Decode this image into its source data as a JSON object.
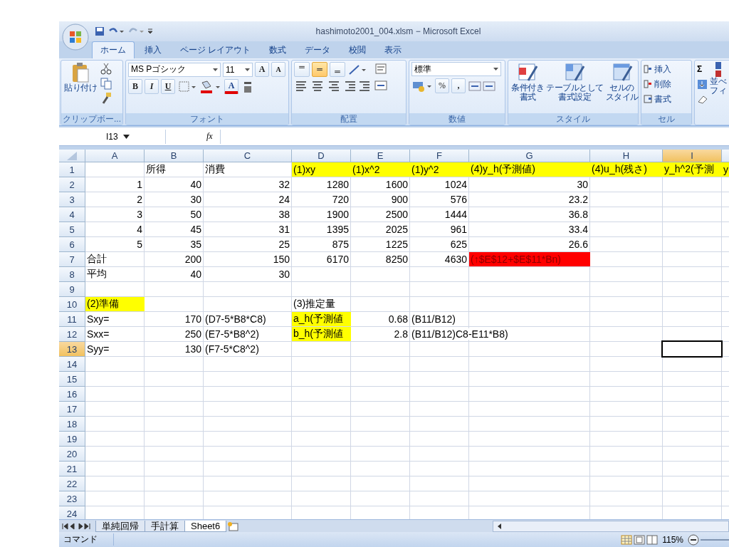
{
  "window": {
    "title": "hashimoto2001_004.xlsm − Microsoft Excel"
  },
  "ribbon_tabs": [
    {
      "label": "ホーム",
      "selected": true
    },
    {
      "label": "挿入",
      "selected": false
    },
    {
      "label": "ページ レイアウト",
      "selected": false
    },
    {
      "label": "数式",
      "selected": false
    },
    {
      "label": "データ",
      "selected": false
    },
    {
      "label": "校閲",
      "selected": false
    },
    {
      "label": "表示",
      "selected": false
    }
  ],
  "ribbon": {
    "clipboard": {
      "paste": "貼り付け",
      "label": "クリップボー..."
    },
    "font": {
      "name": "MS Pゴシック",
      "size": "11",
      "grow": "A",
      "shrink": "A",
      "bold": "B",
      "italic": "I",
      "underline": "U",
      "font_color": "A",
      "label": "フォント"
    },
    "alignment": {
      "vertical": [
        {
          "selected": false
        },
        {
          "selected": true
        },
        {
          "selected": false
        }
      ],
      "label": "配置"
    },
    "number": {
      "format": "標準",
      "percent": "%",
      "comma": ",",
      "label": "数値"
    },
    "styles": {
      "buttons": [
        [
          "条件付き",
          "書式"
        ],
        [
          "テーブルとして",
          "書式設定"
        ],
        [
          "セルの",
          "スタイル"
        ]
      ],
      "label": "スタイル"
    },
    "cells": {
      "buttons": [
        "挿入",
        "削除",
        "書式"
      ],
      "label": "セル"
    },
    "editing": {
      "sum": "Σ",
      "sort": [
        "並べ",
        "フィ"
      ]
    }
  },
  "name_box": "I13",
  "formula_bar": {
    "fx": "fx"
  },
  "columns": [
    {
      "label": "A",
      "selected": false
    },
    {
      "label": "B",
      "selected": false
    },
    {
      "label": "C",
      "selected": false
    },
    {
      "label": "D",
      "selected": false
    },
    {
      "label": "E",
      "selected": false
    },
    {
      "label": "F",
      "selected": false
    },
    {
      "label": "G",
      "selected": false
    },
    {
      "label": "H",
      "selected": false
    },
    {
      "label": "I",
      "selected": true
    }
  ],
  "rows": [
    {
      "label": "1",
      "selected": false,
      "cells": [
        null,
        {
          "text": "所得",
          "kind": "text"
        },
        {
          "text": "消費",
          "kind": "text"
        },
        {
          "text": "(1)xy",
          "kind": "text",
          "color": "#ffff00"
        },
        {
          "text": "(1)x^2",
          "kind": "text",
          "color": "#ffff00"
        },
        {
          "text": "(1)y^2",
          "kind": "text",
          "color": "#ffff00"
        },
        {
          "text": "(4)y_h(予測値)",
          "kind": "text",
          "color": "#ffff00"
        },
        {
          "text": "(4)u_h(残さ)",
          "kind": "text",
          "color": "#ffff00"
        },
        {
          "text": "y_h^2(予測",
          "kind": "text",
          "color": "#ffff00"
        },
        {
          "text": "y",
          "kind": "text",
          "color": "#ffff00"
        }
      ]
    },
    {
      "label": "2",
      "selected": false,
      "cells": [
        {
          "text": "1",
          "kind": "number"
        },
        {
          "text": "40",
          "kind": "number"
        },
        {
          "text": "32",
          "kind": "number"
        },
        {
          "text": "1280",
          "kind": "number"
        },
        {
          "text": "1600",
          "kind": "number"
        },
        {
          "text": "1024",
          "kind": "number"
        },
        {
          "text": "30",
          "kind": "number"
        }
      ]
    },
    {
      "label": "3",
      "selected": false,
      "cells": [
        {
          "text": "2",
          "kind": "number"
        },
        {
          "text": "30",
          "kind": "number"
        },
        {
          "text": "24",
          "kind": "number"
        },
        {
          "text": "720",
          "kind": "number"
        },
        {
          "text": "900",
          "kind": "number"
        },
        {
          "text": "576",
          "kind": "number"
        },
        {
          "text": "23.2",
          "kind": "number"
        }
      ]
    },
    {
      "label": "4",
      "selected": false,
      "cells": [
        {
          "text": "3",
          "kind": "number"
        },
        {
          "text": "50",
          "kind": "number"
        },
        {
          "text": "38",
          "kind": "number"
        },
        {
          "text": "1900",
          "kind": "number"
        },
        {
          "text": "2500",
          "kind": "number"
        },
        {
          "text": "1444",
          "kind": "number"
        },
        {
          "text": "36.8",
          "kind": "number"
        }
      ]
    },
    {
      "label": "5",
      "selected": false,
      "cells": [
        {
          "text": "4",
          "kind": "number"
        },
        {
          "text": "45",
          "kind": "number"
        },
        {
          "text": "31",
          "kind": "number"
        },
        {
          "text": "1395",
          "kind": "number"
        },
        {
          "text": "2025",
          "kind": "number"
        },
        {
          "text": "961",
          "kind": "number"
        },
        {
          "text": "33.4",
          "kind": "number"
        }
      ]
    },
    {
      "label": "6",
      "selected": false,
      "cells": [
        {
          "text": "5",
          "kind": "number"
        },
        {
          "text": "35",
          "kind": "number"
        },
        {
          "text": "25",
          "kind": "number"
        },
        {
          "text": "875",
          "kind": "number"
        },
        {
          "text": "1225",
          "kind": "number"
        },
        {
          "text": "625",
          "kind": "number"
        },
        {
          "text": "26.6",
          "kind": "number"
        }
      ]
    },
    {
      "label": "7",
      "selected": false,
      "cells": [
        {
          "text": "合計",
          "kind": "text"
        },
        {
          "text": "200",
          "kind": "number"
        },
        {
          "text": "150",
          "kind": "number"
        },
        {
          "text": "6170",
          "kind": "number"
        },
        {
          "text": "8250",
          "kind": "number"
        },
        {
          "text": "4630",
          "kind": "number"
        },
        {
          "text": "(↑$E$12+$E$11*Bn)",
          "kind": "text",
          "color": "#ff0000"
        }
      ]
    },
    {
      "label": "8",
      "selected": false,
      "cells": [
        {
          "text": "平均",
          "kind": "text"
        },
        {
          "text": "40",
          "kind": "number"
        },
        {
          "text": "30",
          "kind": "number"
        }
      ]
    },
    {
      "label": "9",
      "selected": false
    },
    {
      "label": "10",
      "selected": false,
      "cells": [
        {
          "text": "(2)準備",
          "kind": "text",
          "color": "#ffff00"
        },
        null,
        null,
        {
          "text": "(3)推定量",
          "kind": "text"
        }
      ]
    },
    {
      "label": "11",
      "selected": false,
      "cells": [
        {
          "text": "Sxy=",
          "kind": "text"
        },
        {
          "text": "170",
          "kind": "number"
        },
        {
          "text": "(D7-5*B8*C8)",
          "kind": "text"
        },
        {
          "text": "a_h(予測値",
          "kind": "text",
          "color": "#ffff00"
        },
        {
          "text": "0.68",
          "kind": "number"
        },
        {
          "text": "(B11/B12)",
          "kind": "text"
        }
      ]
    },
    {
      "label": "12",
      "selected": false,
      "cells": [
        {
          "text": "Sxx=",
          "kind": "text"
        },
        {
          "text": "250",
          "kind": "number"
        },
        {
          "text": "(E7-5*B8^2)",
          "kind": "text"
        },
        {
          "text": "b_h(予測値",
          "kind": "text",
          "color": "#ffff00"
        },
        {
          "text": "2.8",
          "kind": "number"
        },
        {
          "text": "(B11/B12)C8-E11*B8)",
          "kind": "text"
        }
      ]
    },
    {
      "label": "13",
      "selected": true,
      "cells": [
        {
          "text": "Syy=",
          "kind": "text"
        },
        {
          "text": "130",
          "kind": "number"
        },
        {
          "text": "(F7-5*C8^2)",
          "kind": "text"
        }
      ]
    },
    {
      "label": "14",
      "selected": false
    },
    {
      "label": "15",
      "selected": false
    },
    {
      "label": "16",
      "selected": false
    },
    {
      "label": "17",
      "selected": false
    },
    {
      "label": "18",
      "selected": false
    },
    {
      "label": "19",
      "selected": false
    },
    {
      "label": "20",
      "selected": false
    },
    {
      "label": "21",
      "selected": false
    },
    {
      "label": "22",
      "selected": false
    },
    {
      "label": "23",
      "selected": false
    },
    {
      "label": "24",
      "selected": false
    }
  ],
  "sheet_tabs": [
    {
      "label": "単純回帰",
      "selected": false
    },
    {
      "label": "手計算",
      "selected": false
    },
    {
      "label": "Sheet6",
      "selected": true
    }
  ],
  "status_bar": {
    "mode": "コマンド",
    "zoom": "115%"
  }
}
